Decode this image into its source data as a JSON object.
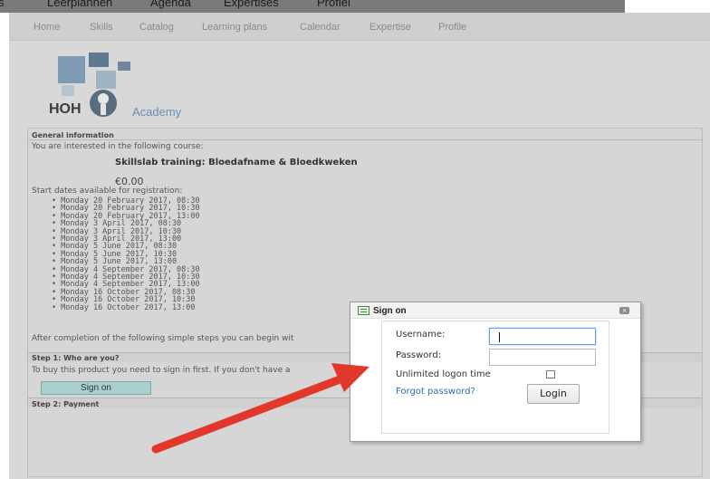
{
  "top_nav": {
    "items": [
      "s",
      "Leerplannen",
      "Agenda",
      "Expertises",
      "Profiel"
    ]
  },
  "nav": {
    "items": [
      "Home",
      "Skills",
      "Catalog",
      "Learning plans",
      "Calendar",
      "Expertise",
      "Profile"
    ]
  },
  "logo": {
    "left": "HOH",
    "right": "Academy"
  },
  "general": {
    "heading": "General information",
    "intro": "You are interested in the following course:",
    "course": "Skillslab training: Bloedafname & Bloedkweken",
    "price": "€0.00",
    "dates_intro": "Start dates available for registration:",
    "dates": [
      "Monday 20 February 2017, 08:30",
      "Monday 20 February 2017, 10:30",
      "Monday 20 February 2017, 13:00",
      "Monday 3 April 2017, 08:30",
      "Monday 3 April 2017, 10:30",
      "Monday 3 April 2017, 13:00",
      "Monday 5 June 2017, 08:30",
      "Monday 5 June 2017, 10:30",
      "Monday 5 June 2017, 13:00",
      "Monday 4 September 2017, 08:30",
      "Monday 4 September 2017, 10:30",
      "Monday 4 September 2017, 13:00",
      "Monday 16 October 2017, 08:30",
      "Monday 16 October 2017, 10:30",
      "Monday 16 October 2017, 13:00"
    ],
    "completion": "After completion of the following simple steps you can begin wit"
  },
  "step1": {
    "heading": "Step 1: Who are you?",
    "text": "To buy this product you need to sign in first. If you don't have a",
    "button": "Sign on"
  },
  "step2": {
    "heading": "Step 2: Payment"
  },
  "dialog": {
    "title": "Sign on",
    "close": "×",
    "username_label": "Username:",
    "username_value": "",
    "password_label": "Password:",
    "password_value": "",
    "unlimited_label": "Unlimited logon time",
    "unlimited_checked": false,
    "forgot": "Forgot password?",
    "login": "Login"
  },
  "colors": {
    "overlay_bg": "#d8d8d8",
    "signon_button": "#a9cfcf",
    "link": "#2a6fb0",
    "arrow": "#e2382b"
  }
}
